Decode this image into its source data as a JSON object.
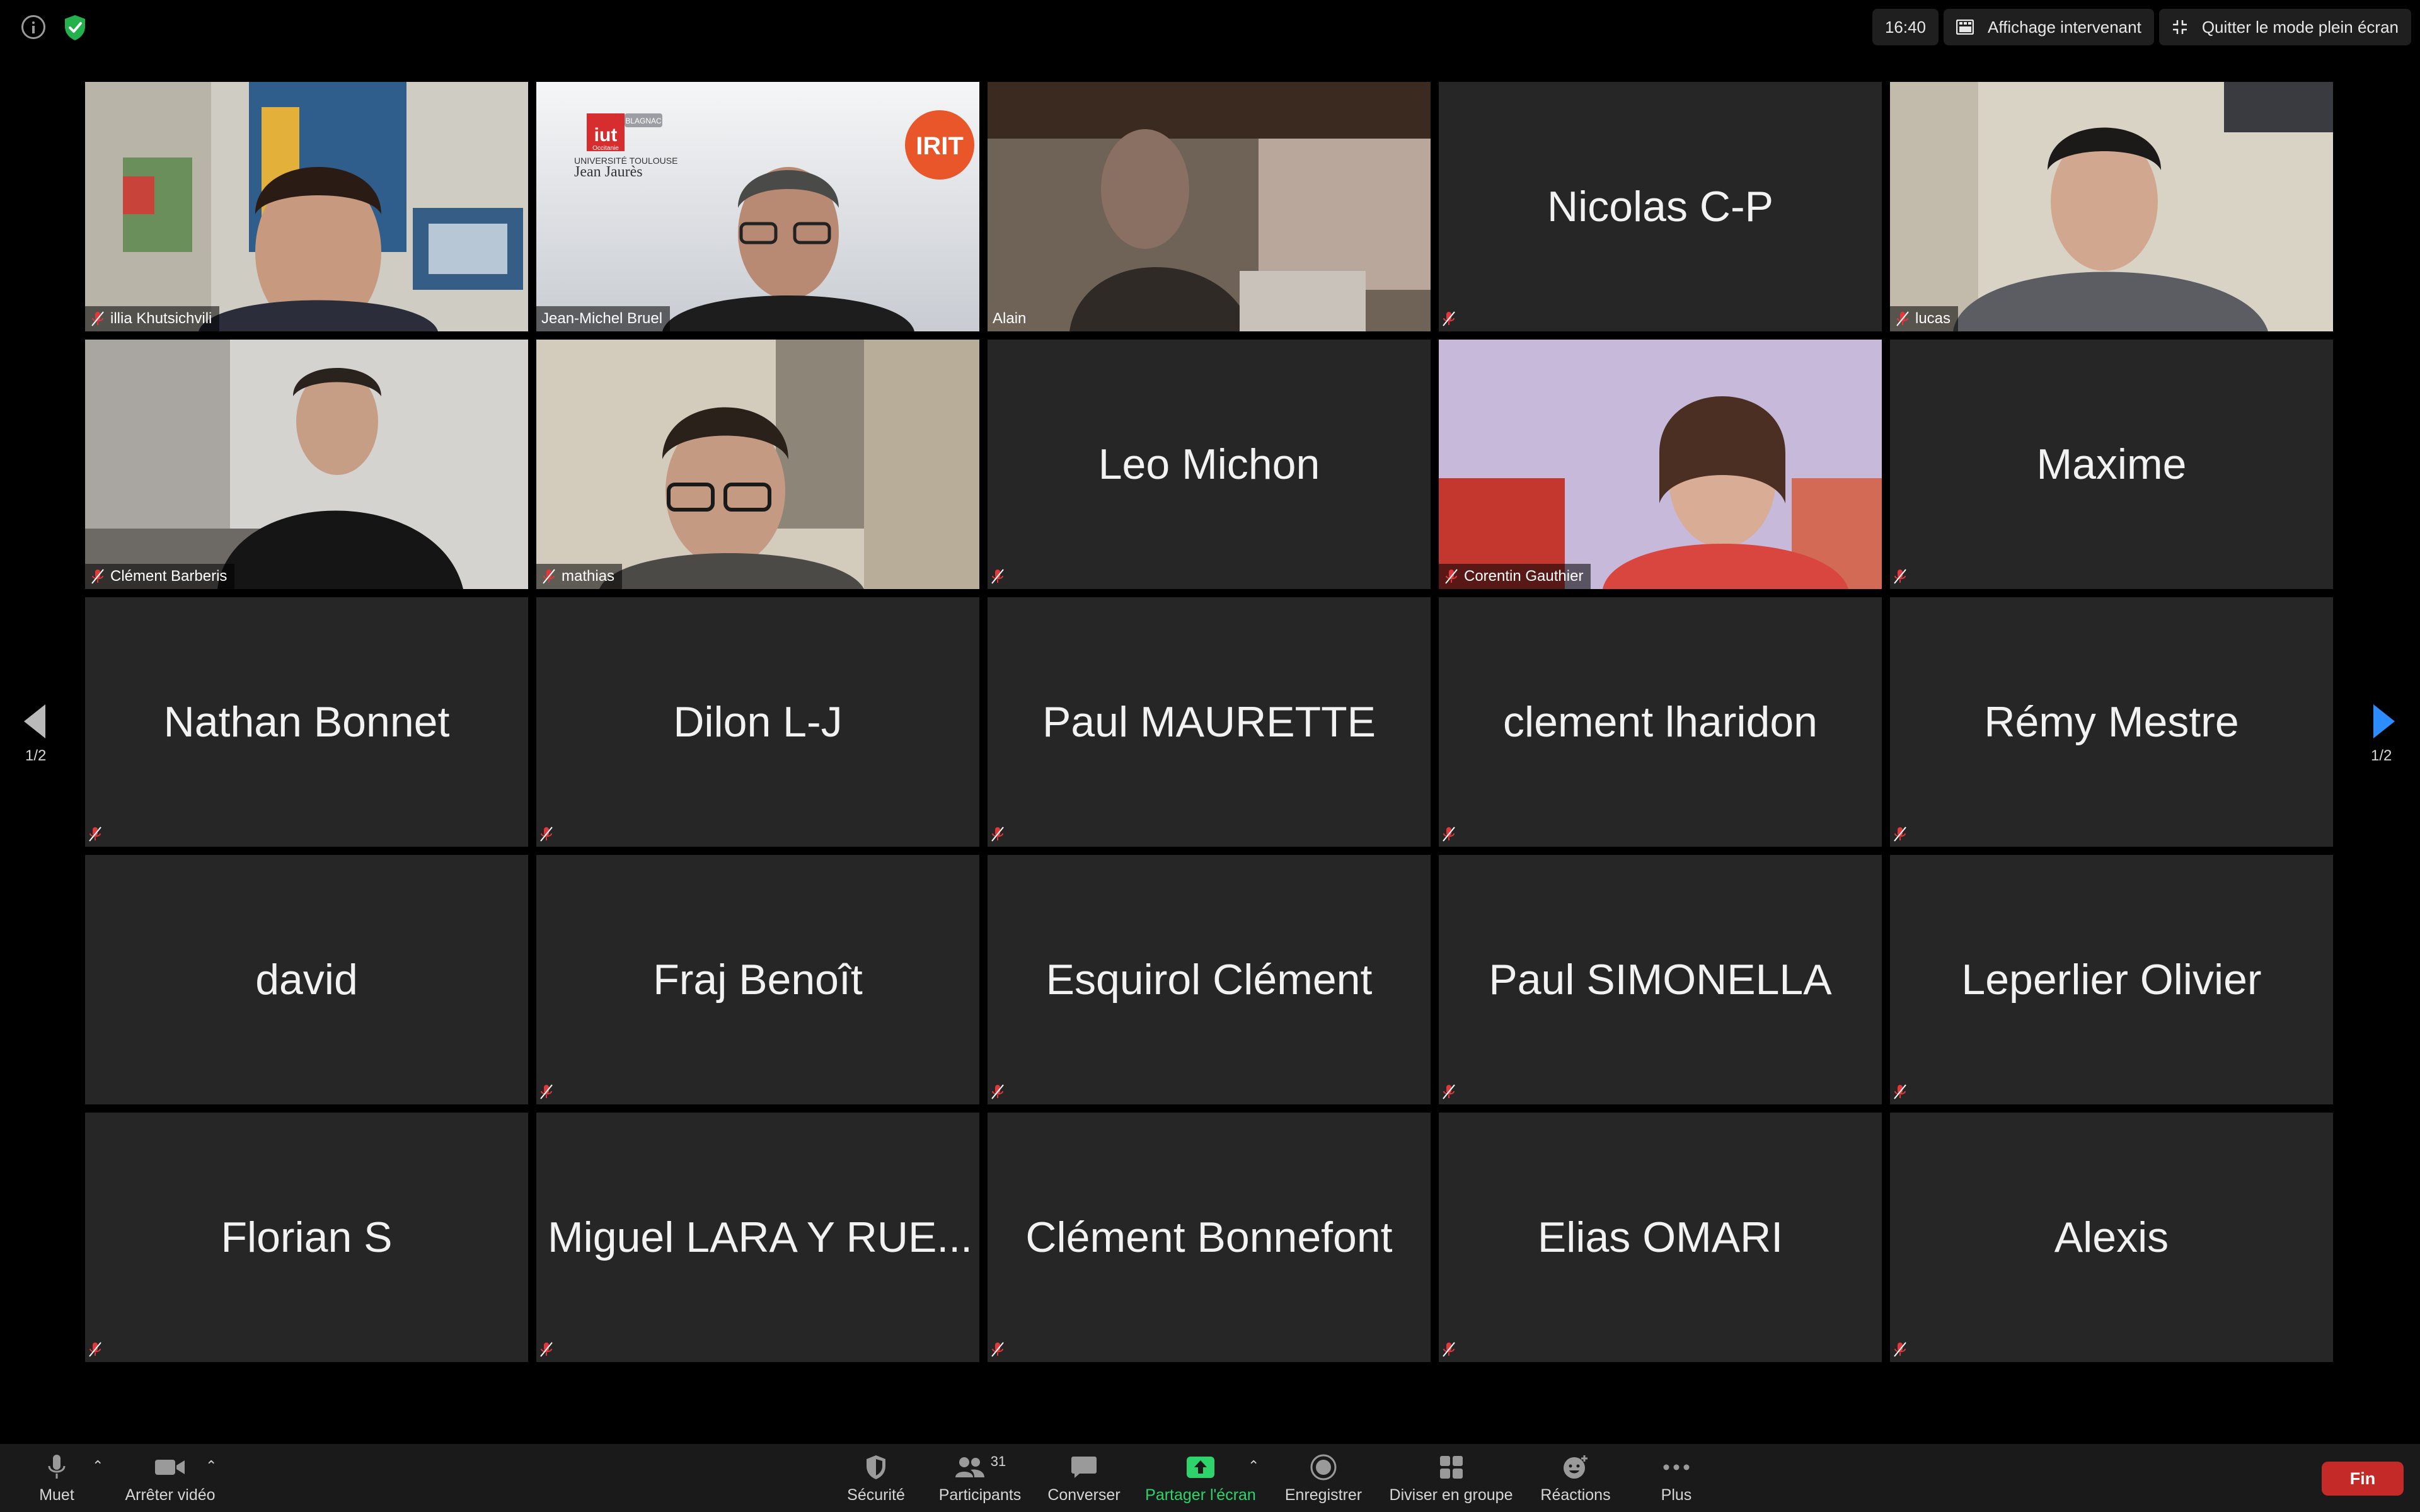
{
  "topbar": {
    "time": "16:40",
    "speaker_view_label": "Affichage intervenant",
    "exit_fullscreen_label": "Quitter le mode plein écran"
  },
  "pagination": {
    "left": "1/2",
    "right": "1/2"
  },
  "tiles": [
    {
      "name": "illia Khutsichvili",
      "video": true,
      "muted": true
    },
    {
      "name": "Jean-Michel Bruel",
      "video": true,
      "muted": false,
      "active_speaker": true,
      "background_text": {
        "iut": "iut",
        "occitanie": "Occitanie",
        "blagnac": "BLAGNAC",
        "univ_line": "UNIVERSITÉ TOULOUSE",
        "jean_jaures": "Jean Jaurès",
        "irit": "IRIT"
      }
    },
    {
      "name": "Alain",
      "video": true,
      "muted": false
    },
    {
      "name": "Nicolas C-P",
      "video": false,
      "muted": true
    },
    {
      "name": "lucas",
      "video": true,
      "muted": true
    },
    {
      "name": "Clément Barberis",
      "video": true,
      "muted": true
    },
    {
      "name": "mathias",
      "video": true,
      "muted": true
    },
    {
      "name": "Leo Michon",
      "video": false,
      "muted": true
    },
    {
      "name": "Corentin Gauthier",
      "video": true,
      "muted": true
    },
    {
      "name": "Maxime",
      "video": false,
      "muted": true
    },
    {
      "name": "Nathan Bonnet",
      "video": false,
      "muted": true
    },
    {
      "name": "Dilon L-J",
      "video": false,
      "muted": true
    },
    {
      "name": "Paul MAURETTE",
      "video": false,
      "muted": true
    },
    {
      "name": "clement lharidon",
      "video": false,
      "muted": true
    },
    {
      "name": "Rémy Mestre",
      "video": false,
      "muted": true
    },
    {
      "name": "david",
      "video": false,
      "muted": false
    },
    {
      "name": "Fraj Benoît",
      "video": false,
      "muted": true
    },
    {
      "name": "Esquirol Clément",
      "video": false,
      "muted": true
    },
    {
      "name": "Paul SIMONELLA",
      "video": false,
      "muted": true
    },
    {
      "name": "Leperlier Olivier",
      "video": false,
      "muted": true
    },
    {
      "name": "Florian S",
      "video": false,
      "muted": true
    },
    {
      "name": "Miguel LARA Y RUE...",
      "video": false,
      "muted": true
    },
    {
      "name": "Clément Bonnefont",
      "video": false,
      "muted": true
    },
    {
      "name": "Elias OMARI",
      "video": false,
      "muted": true
    },
    {
      "name": "Alexis",
      "video": false,
      "muted": true
    }
  ],
  "toolbar": {
    "mute": "Muet",
    "stop_video": "Arrêter vidéo",
    "security": "Sécurité",
    "participants": "Participants",
    "participants_count": "31",
    "chat": "Converser",
    "share_screen": "Partager l'écran",
    "record": "Enregistrer",
    "breakout": "Diviser en groupe",
    "reactions": "Réactions",
    "more": "Plus",
    "end": "Fin"
  },
  "colors": {
    "accent_blue": "#2d8cff",
    "share_green": "#2fd36b",
    "end_red": "#c42b28",
    "active_border": "#d8e88a",
    "tile_bg": "#262626",
    "mute_red": "#e0383b"
  },
  "icons": [
    "info-icon",
    "shield-check-icon",
    "speaker-view-icon",
    "exit-fullscreen-icon",
    "microphone-icon",
    "video-camera-icon",
    "shield-icon",
    "participants-icon",
    "chat-bubble-icon",
    "share-screen-icon",
    "record-icon",
    "breakout-rooms-icon",
    "reactions-icon",
    "more-dots-icon",
    "muted-mic-icon"
  ]
}
